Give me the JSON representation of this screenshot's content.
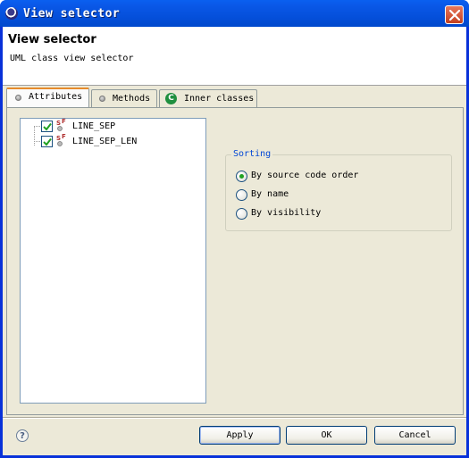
{
  "window": {
    "title": "View selector",
    "icon": "eclipse-icon",
    "close_icon": "close-icon"
  },
  "header": {
    "title": "View selector",
    "description": "UML class view selector"
  },
  "tabs": [
    {
      "label": "Attributes",
      "icon": "attribute-dot-icon",
      "active": true
    },
    {
      "label": "Methods",
      "icon": "method-dot-icon",
      "active": false
    },
    {
      "label": "Inner classes",
      "icon": "class-c-icon",
      "active": false
    }
  ],
  "attributes": [
    {
      "label": "LINE_SEP",
      "checked": true,
      "icon": "static-final-field-icon"
    },
    {
      "label": "LINE_SEP_LEN",
      "checked": true,
      "icon": "static-final-field-icon"
    }
  ],
  "sorting": {
    "legend": "Sorting",
    "options": [
      {
        "label": "By source code order",
        "selected": true
      },
      {
        "label": "By name",
        "selected": false
      },
      {
        "label": "By visibility",
        "selected": false
      }
    ]
  },
  "buttons": {
    "apply": "Apply",
    "ok": "OK",
    "cancel": "Cancel"
  },
  "help": {
    "glyph": "?",
    "icon": "help-icon"
  }
}
